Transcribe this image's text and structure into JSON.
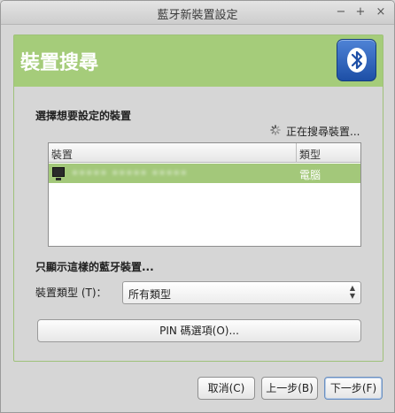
{
  "window": {
    "title": "藍牙新裝置設定",
    "controls": {
      "minimize": "−",
      "maximize": "+",
      "close": "×"
    }
  },
  "banner": {
    "title": "裝置搜尋",
    "icon": "bluetooth-icon",
    "accent": "#a5cc7a"
  },
  "device_section": {
    "label": "選擇想要設定的裝置",
    "status": "正在搜尋裝置...",
    "columns": [
      "裝置",
      "類型"
    ],
    "rows": [
      {
        "name": "••••• ••••• •••••",
        "type": "電腦",
        "selected": true,
        "icon": "monitor-icon"
      }
    ]
  },
  "filter": {
    "label": "只顯示這樣的藍牙裝置...",
    "type_label": "裝置類型 (T)：",
    "type_value": "所有類型"
  },
  "pin_button": "PIN 碼選項(O)...",
  "footer": {
    "cancel": "取消(C)",
    "back": "上一步(B)",
    "next": "下一步(F)"
  }
}
